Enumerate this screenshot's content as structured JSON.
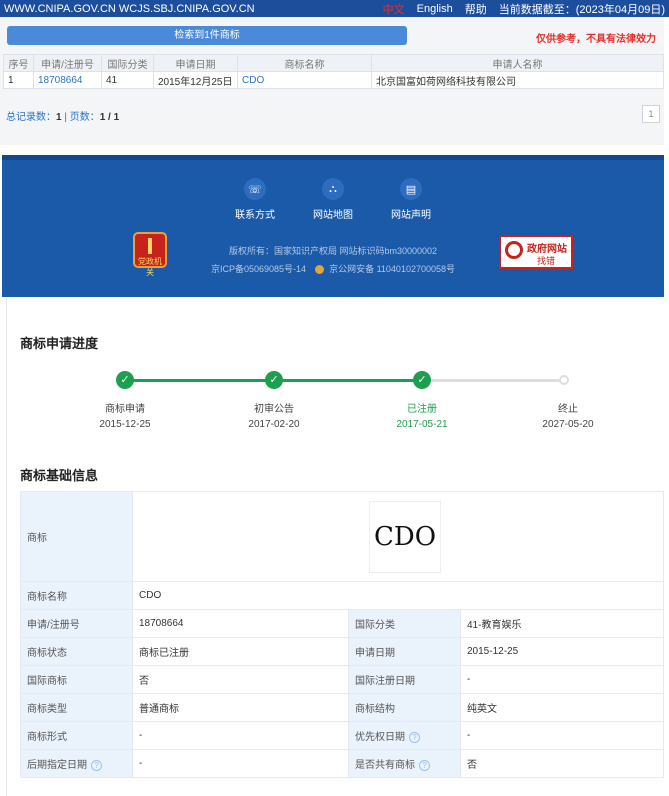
{
  "topbar": {
    "sites": "WWW.CNIPA.GOV.CN WCJS.SBJ.CNIPA.GOV.CN",
    "lang_zh": "中文",
    "lang_en": "English",
    "help": "帮助",
    "data_date": "当前数据截至：(2023年04月09日)"
  },
  "result": {
    "banner": "检索到1件商标",
    "disclaimer": "仅供参考，不具有法律效力",
    "columns": [
      "序号",
      "申请/注册号",
      "国际分类",
      "申请日期",
      "商标名称",
      "申请人名称"
    ],
    "rows": [
      [
        "1",
        "18708664",
        "41",
        "2015年12月25日",
        "CDO",
        "北京国富如荷网络科技有限公司"
      ]
    ],
    "pager_total_label": "总记录数：",
    "pager_total": "1",
    "pager_sep": " | ",
    "pager_pages_label": "页数：",
    "pager_pages": "1 / 1",
    "page_button": "1"
  },
  "footer": {
    "nav": [
      {
        "icon": "phone-icon",
        "glyph": "☏",
        "label": "联系方式"
      },
      {
        "icon": "sitemap-icon",
        "glyph": "⛬",
        "label": "网站地图"
      },
      {
        "icon": "document-icon",
        "glyph": "▤",
        "label": "网站声明"
      }
    ],
    "emblem_text": "党政机关",
    "copyright": "版权所有：国家知识产权局 网站标识码bm30000002",
    "icp": "京ICP备05069085号-14",
    "police": "京公网安备 11040102700058号",
    "gov_title": "政府网站",
    "gov_action": "找错"
  },
  "progress": {
    "title": "商标申请进度",
    "steps": [
      {
        "label": "商标申请",
        "date": "2015-12-25",
        "state": "done"
      },
      {
        "label": "初审公告",
        "date": "2017-02-20",
        "state": "done"
      },
      {
        "label": "已注册",
        "date": "2017-05-21",
        "state": "current"
      },
      {
        "label": "终止",
        "date": "2027-05-20",
        "state": "pending"
      }
    ],
    "colors": {
      "done": "#1e9e4f",
      "pending": "#dddddd"
    }
  },
  "basic": {
    "title": "商标基础信息",
    "logo_label": "商标",
    "logo_text": "CDO",
    "name_label": "商标名称",
    "name_value": "CDO",
    "rows": [
      {
        "k1": "申请/注册号",
        "v1": "18708664",
        "k2": "国际分类",
        "v2": "41-教育娱乐"
      },
      {
        "k1": "商标状态",
        "v1": "商标已注册",
        "k2": "申请日期",
        "v2": "2015-12-25"
      },
      {
        "k1": "国际商标",
        "v1": "否",
        "k2": "国际注册日期",
        "v2": "-"
      },
      {
        "k1": "商标类型",
        "v1": "普通商标",
        "k2": "商标结构",
        "v2": "纯英文"
      },
      {
        "k1": "商标形式",
        "v1": "-",
        "k2": "优先权日期",
        "v2": "-"
      },
      {
        "k1": "后期指定日期",
        "v1": "-",
        "k2": "是否共有商标",
        "v2": "否"
      }
    ],
    "help_glyph": "?"
  }
}
